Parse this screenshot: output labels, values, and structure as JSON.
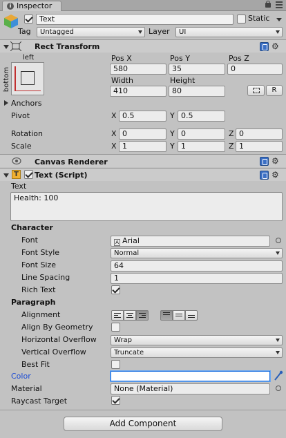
{
  "window": {
    "tab_title": "Inspector",
    "lock_icon": "lock-icon",
    "menu_icon": "tab-menu-icon"
  },
  "object": {
    "active": true,
    "name": "Text",
    "static_label": "Static",
    "static": false,
    "tag_label": "Tag",
    "tag_value": "Untagged",
    "layer_label": "Layer",
    "layer_value": "UI"
  },
  "rect_transform": {
    "title": "Rect Transform",
    "anchor_h_label": "left",
    "anchor_v_label": "bottom",
    "pos_x_label": "Pos X",
    "pos_y_label": "Pos Y",
    "pos_z_label": "Pos Z",
    "pos_x": "580",
    "pos_y": "35",
    "pos_z": "0",
    "width_label": "Width",
    "height_label": "Height",
    "width": "410",
    "height": "80",
    "r_button": "R",
    "anchors_label": "Anchors",
    "pivot_label": "Pivot",
    "pivot_x": "0.5",
    "pivot_y": "0.5",
    "rotation_label": "Rotation",
    "rot_x": "0",
    "rot_y": "0",
    "rot_z": "0",
    "scale_label": "Scale",
    "scale_x": "1",
    "scale_y": "1",
    "scale_z": "1",
    "x_label": "X",
    "y_label": "Y",
    "z_label": "Z"
  },
  "canvas_renderer": {
    "title": "Canvas Renderer"
  },
  "text_script": {
    "title": "Text (Script)",
    "enabled": true,
    "text_label": "Text",
    "text_value": "Health: 100",
    "character_header": "Character",
    "font_label": "Font",
    "font_value": "Arial",
    "font_style_label": "Font Style",
    "font_style_value": "Normal",
    "font_size_label": "Font Size",
    "font_size_value": "64",
    "line_spacing_label": "Line Spacing",
    "line_spacing_value": "1",
    "rich_text_label": "Rich Text",
    "rich_text": true,
    "paragraph_header": "Paragraph",
    "alignment_label": "Alignment",
    "align_by_geometry_label": "Align By Geometry",
    "align_by_geometry": false,
    "h_overflow_label": "Horizontal Overflow",
    "h_overflow_value": "Wrap",
    "v_overflow_label": "Vertical Overflow",
    "v_overflow_value": "Truncate",
    "best_fit_label": "Best Fit",
    "best_fit": false,
    "color_label": "Color",
    "color_value": "#ffffff",
    "material_label": "Material",
    "material_value": "None (Material)",
    "raycast_label": "Raycast Target",
    "raycast": true
  },
  "footer": {
    "add_component": "Add Component"
  },
  "colors": {
    "panel_bg": "#c2c2c2",
    "color_label": "#1a4bd6",
    "color_field_border": "#1a6fe0"
  }
}
